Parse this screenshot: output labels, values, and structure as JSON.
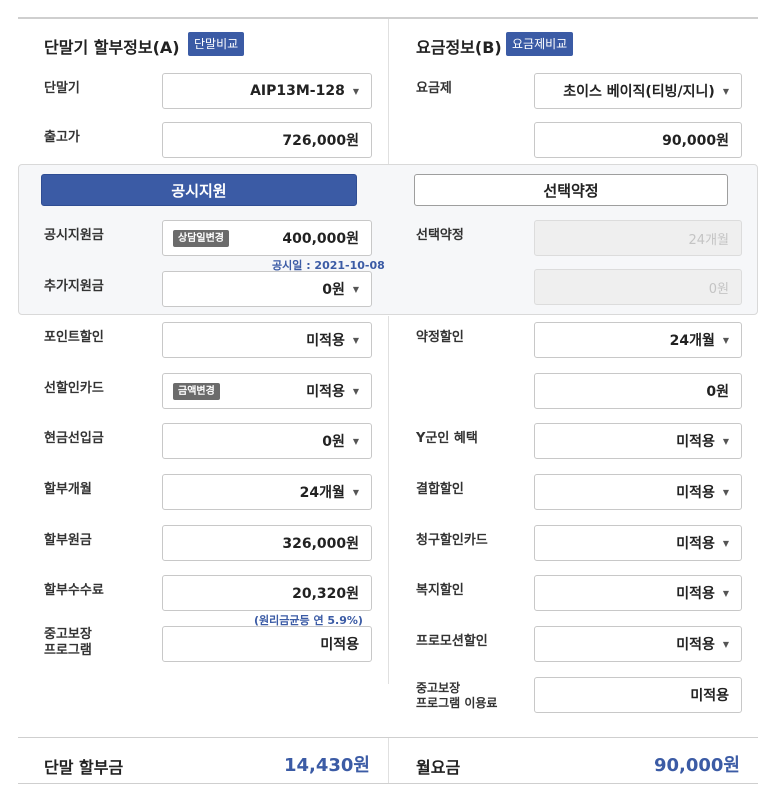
{
  "sections": {
    "device": {
      "title": "단말기 할부정보(A)",
      "compare_label": "단말비교"
    },
    "plan": {
      "title": "요금정보(B)",
      "compare_label": "요금제비교"
    }
  },
  "left": {
    "device": {
      "label": "단말기",
      "value": "AIP13M-128"
    },
    "release_price": {
      "label": "출고가",
      "value": "726,000원"
    },
    "public_support": {
      "label": "공시지원금",
      "badge": "상담일변경",
      "value": "400,000원",
      "note": "공시일 : 2021-10-08"
    },
    "extra_support": {
      "label": "추가지원금",
      "value": "0원"
    },
    "point_discount": {
      "label": "포인트할인",
      "value": "미적용"
    },
    "prepay_card": {
      "label": "선할인카드",
      "badge": "금액변경",
      "value": "미적용"
    },
    "cash_prepay": {
      "label": "현금선입금",
      "value": "0원"
    },
    "months": {
      "label": "할부개월",
      "value": "24개월"
    },
    "principal": {
      "label": "할부원금",
      "value": "326,000원"
    },
    "fee": {
      "label": "할부수수료",
      "value": "20,320원",
      "note": "(원리금균등 연 5.9%)"
    },
    "used_guarantee": {
      "label_line1": "중고보장",
      "label_line2": "프로그램",
      "value": "미적용"
    }
  },
  "right": {
    "plan": {
      "label": "요금제",
      "value": "초이스 베이직(티빙/지니)"
    },
    "plan_price": {
      "value": "90,000원"
    },
    "select_contract": {
      "label": "선택약정",
      "value": "24개월"
    },
    "select_contract_amount": {
      "value": "0원"
    },
    "contract_discount": {
      "label": "약정할인",
      "value": "24개월"
    },
    "contract_amount": {
      "value": "0원"
    },
    "y_benefit": {
      "label": "Y군인 혜택",
      "value": "미적용"
    },
    "bundle_discount": {
      "label": "결합할인",
      "value": "미적용"
    },
    "billing_card": {
      "label": "청구할인카드",
      "value": "미적용"
    },
    "welfare": {
      "label": "복지할인",
      "value": "미적용"
    },
    "promotion": {
      "label": "프로모션할인",
      "value": "미적용"
    },
    "used_guarantee_fee": {
      "label_line1": "중고보장",
      "label_line2": "프로그램 이용료",
      "value": "미적용"
    }
  },
  "tabs": {
    "public_support": "공시지원",
    "select_contract": "선택약정"
  },
  "summary": {
    "device_label": "단말 할부금",
    "device_value": "14,430원",
    "monthly_label": "월요금",
    "monthly_value": "90,000원"
  },
  "colors": {
    "accent": "#3b5ba5",
    "disabled": "#efefef"
  }
}
